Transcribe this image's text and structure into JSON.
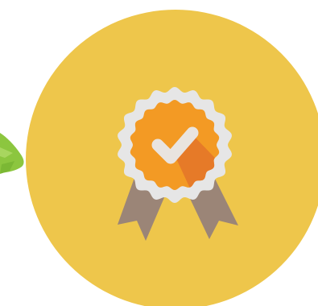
{
  "illustration": {
    "icon": "award-badge-checkmark-icon",
    "colors": {
      "background_circle": "#EEC64B",
      "badge_outer": "#E6E6E6",
      "badge_inner": "#F39A24",
      "badge_shadow": "#E67A28",
      "checkmark": "#E9E4DF",
      "ribbon": "#9B8577",
      "brush_stroke": "#8CC63F"
    }
  }
}
